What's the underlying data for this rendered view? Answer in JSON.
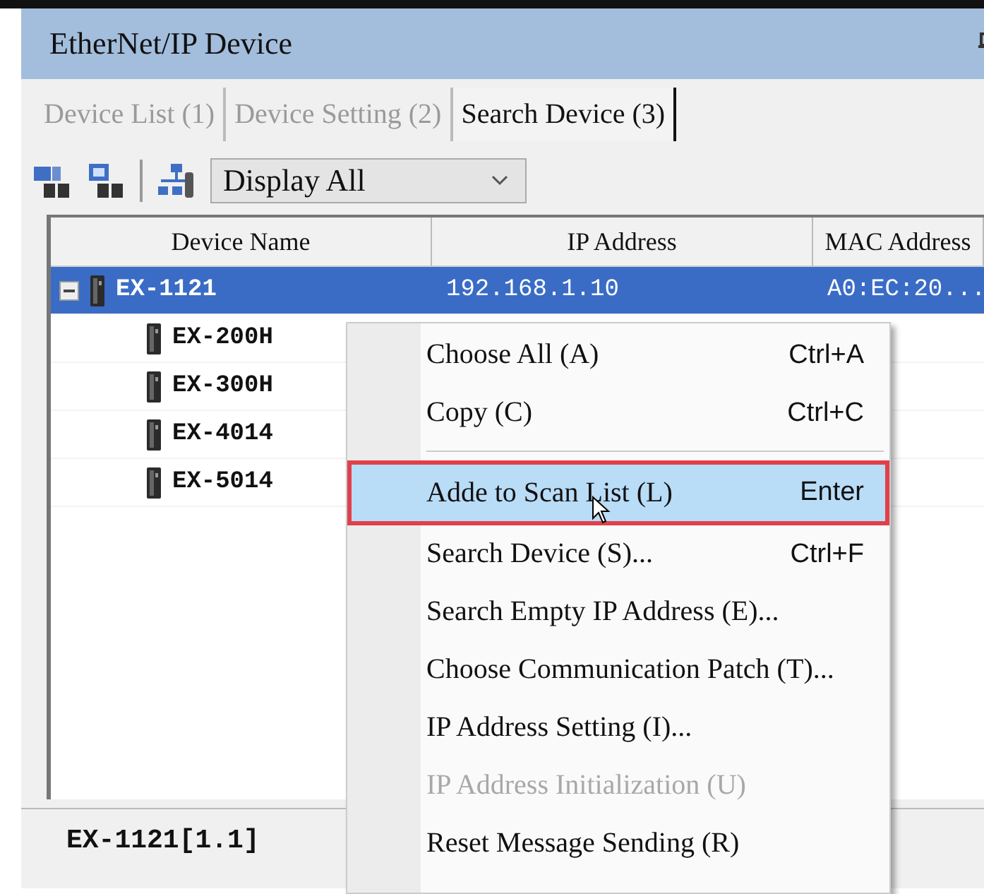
{
  "panel": {
    "title": "EtherNet/IP Device"
  },
  "tabs": [
    {
      "label": "Device List (1)",
      "selected": false
    },
    {
      "label": "Device Setting (2)",
      "selected": false
    },
    {
      "label": "Search Device (3)",
      "selected": true
    }
  ],
  "toolbar": {
    "filter": "Display All"
  },
  "table": {
    "columns": [
      "Device Name",
      "IP Address",
      "MAC Address"
    ],
    "rows": [
      {
        "name": "EX-1121",
        "ip": "192.168.1.10",
        "mac": "A0:EC:20...",
        "selected": true,
        "expanded": true,
        "children": [
          {
            "name": "EX-200H",
            "selected": false
          },
          {
            "name": "EX-300H",
            "selected": false
          },
          {
            "name": "EX-4014",
            "selected": false
          },
          {
            "name": "EX-5014",
            "selected": false
          }
        ]
      }
    ]
  },
  "status": "EX-1121[1.1]",
  "context_menu": [
    {
      "kind": "item",
      "label": "Choose All (A)",
      "shortcut": "Ctrl+A",
      "selected": false,
      "disabled": false
    },
    {
      "kind": "item",
      "label": "Copy (C)",
      "shortcut": "Ctrl+C",
      "selected": false,
      "disabled": false
    },
    {
      "kind": "separator"
    },
    {
      "kind": "item",
      "label": "Adde to Scan List (L)",
      "shortcut": "Enter",
      "selected": true,
      "disabled": false
    },
    {
      "kind": "item",
      "label": "Search Device (S)...",
      "shortcut": "Ctrl+F",
      "selected": false,
      "disabled": false
    },
    {
      "kind": "item",
      "label": "Search Empty IP Address (E)...",
      "selected": false,
      "disabled": false
    },
    {
      "kind": "item",
      "label": "Choose Communication Patch (T)...",
      "selected": false,
      "disabled": false
    },
    {
      "kind": "item",
      "label": "IP Address Setting (I)...",
      "selected": false,
      "disabled": false
    },
    {
      "kind": "item",
      "label": "IP Address Initialization (U)",
      "selected": false,
      "disabled": true
    },
    {
      "kind": "item",
      "label": "Reset Message Sending (R)",
      "selected": false,
      "disabled": false
    }
  ]
}
